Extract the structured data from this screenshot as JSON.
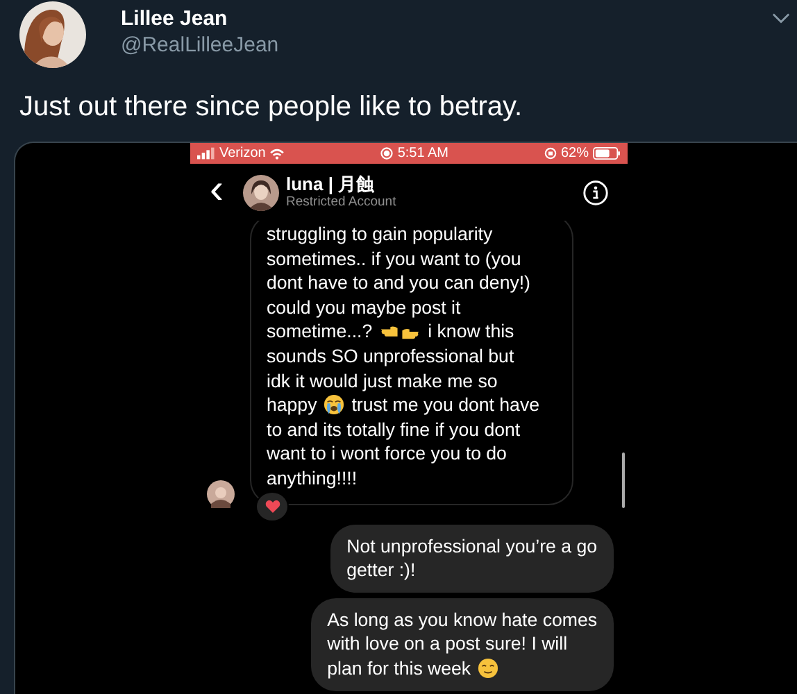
{
  "tweet": {
    "author": "Lillee Jean",
    "handle": "@RealLilleeJean",
    "text": "Just out there since people like to betray."
  },
  "phone": {
    "status_bar": {
      "carrier": "Verizon",
      "time": "5:51 AM",
      "battery": "62%"
    },
    "header": {
      "back": "‹",
      "name": "luna | 月蝕",
      "subtitle": "Restricted Account"
    },
    "messages": [
      {
        "kind": "received",
        "reaction": true,
        "lines": [
          [
            {
              "kind": "text",
              "text": "struggling to gain popularity"
            }
          ],
          [
            {
              "kind": "text",
              "text": "sometimes.. if you want to (you"
            }
          ],
          [
            {
              "kind": "text",
              "text": "dont have to and you can deny!)"
            }
          ],
          [
            {
              "kind": "text",
              "text": "could you maybe post it"
            }
          ],
          [
            {
              "kind": "text",
              "text": "sometime...?"
            },
            {
              "kind": "hands"
            },
            {
              "kind": "text",
              "text": "i know this"
            }
          ],
          [
            {
              "kind": "text",
              "text": "sounds SO unprofessional but"
            }
          ],
          [
            {
              "kind": "text",
              "text": "idk it would just make me so"
            }
          ],
          [
            {
              "kind": "text",
              "text": "happy"
            },
            {
              "kind": "crying"
            },
            {
              "kind": "text",
              "text": "trust me you dont have"
            }
          ],
          [
            {
              "kind": "text",
              "text": "to and its totally fine if you dont"
            }
          ],
          [
            {
              "kind": "text",
              "text": "want to i wont force you to do"
            }
          ],
          [
            {
              "kind": "text",
              "text": "anything!!!!"
            }
          ]
        ]
      },
      {
        "kind": "sent",
        "lines": [
          [
            {
              "kind": "text",
              "text": "Not unprofessional you’re a go"
            }
          ],
          [
            {
              "kind": "text",
              "text": "getter :)!"
            }
          ]
        ]
      },
      {
        "kind": "sent",
        "lines": [
          [
            {
              "kind": "text",
              "text": "As long as you know hate comes"
            }
          ],
          [
            {
              "kind": "text",
              "text": "with love on a post sure! I will"
            }
          ],
          [
            {
              "kind": "text",
              "text": "plan for this week"
            },
            {
              "kind": "relieved"
            }
          ]
        ]
      }
    ]
  }
}
